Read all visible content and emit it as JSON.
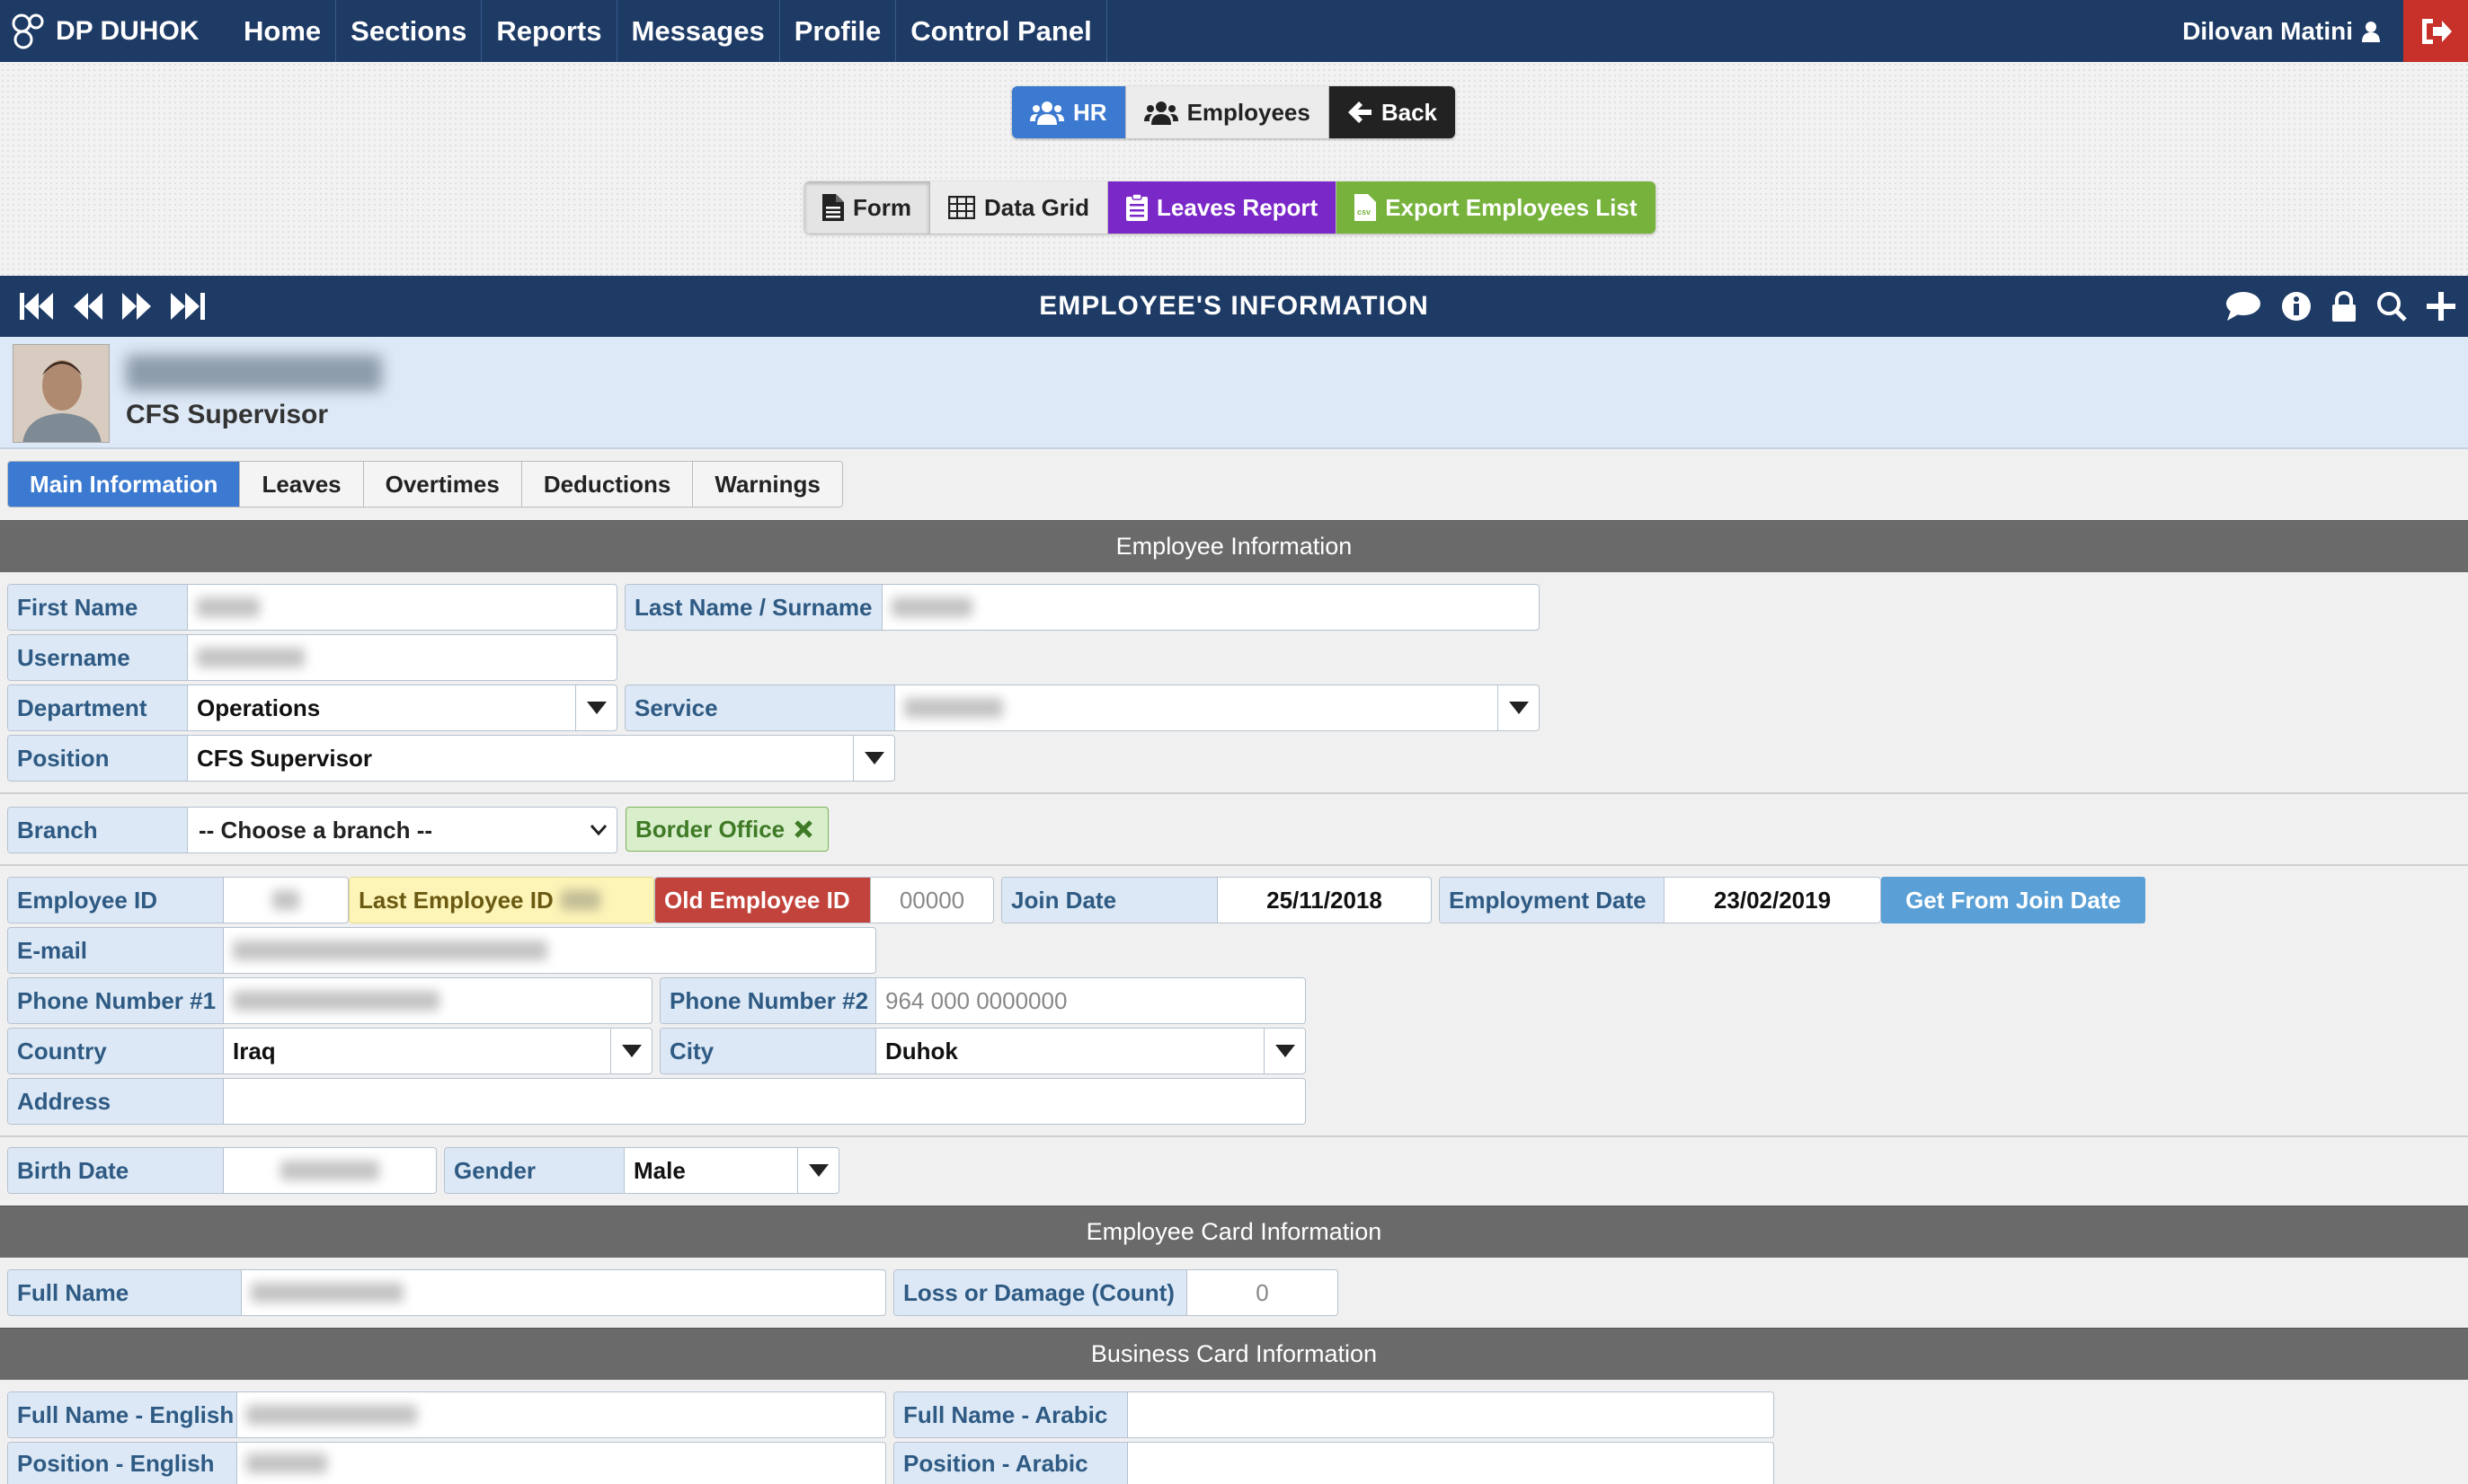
{
  "nav": {
    "brand": "DP DUHOK",
    "items": [
      "Home",
      "Sections",
      "Reports",
      "Messages",
      "Profile",
      "Control Panel"
    ],
    "user": "Dilovan Matini"
  },
  "subnav": {
    "hr": "HR",
    "employees": "Employees",
    "back": "Back"
  },
  "toolbar": {
    "form": "Form",
    "data_grid": "Data Grid",
    "leaves_report": "Leaves Report",
    "export": "Export Employees List"
  },
  "panel": {
    "title": "EMPLOYEE'S INFORMATION"
  },
  "profile": {
    "position": "CFS Supervisor"
  },
  "tabs": [
    "Main Information",
    "Leaves",
    "Overtimes",
    "Deductions",
    "Warnings"
  ],
  "sections": {
    "employee_info": "Employee Information",
    "card_info": "Employee Card Information",
    "business_card": "Business Card Information"
  },
  "fields": {
    "first_name": "First Name",
    "last_name": "Last Name / Surname",
    "username": "Username",
    "department": "Department",
    "department_value": "Operations",
    "service": "Service",
    "position": "Position",
    "position_value": "CFS Supervisor",
    "branch": "Branch",
    "branch_placeholder": "-- Choose a branch --",
    "branch_tag": "Border Office",
    "employee_id": "Employee ID",
    "last_employee_id": "Last Employee ID",
    "old_employee_id": "Old Employee ID",
    "old_employee_id_value": "00000",
    "join_date": "Join Date",
    "join_date_value": "25/11/2018",
    "employment_date": "Employment Date",
    "employment_date_value": "23/02/2019",
    "get_from_join": "Get From Join Date",
    "email": "E-mail",
    "phone1": "Phone Number #1",
    "phone2": "Phone Number #2",
    "phone2_placeholder": "964 000 0000000",
    "country": "Country",
    "country_value": "Iraq",
    "city": "City",
    "city_value": "Duhok",
    "address": "Address",
    "birth_date": "Birth Date",
    "gender": "Gender",
    "gender_value": "Male",
    "full_name": "Full Name",
    "loss_damage": "Loss or Damage (Count)",
    "loss_damage_value": "0",
    "full_name_en": "Full Name - English",
    "full_name_ar": "Full Name - Arabic",
    "position_en": "Position - English",
    "position_ar": "Position - Arabic"
  }
}
